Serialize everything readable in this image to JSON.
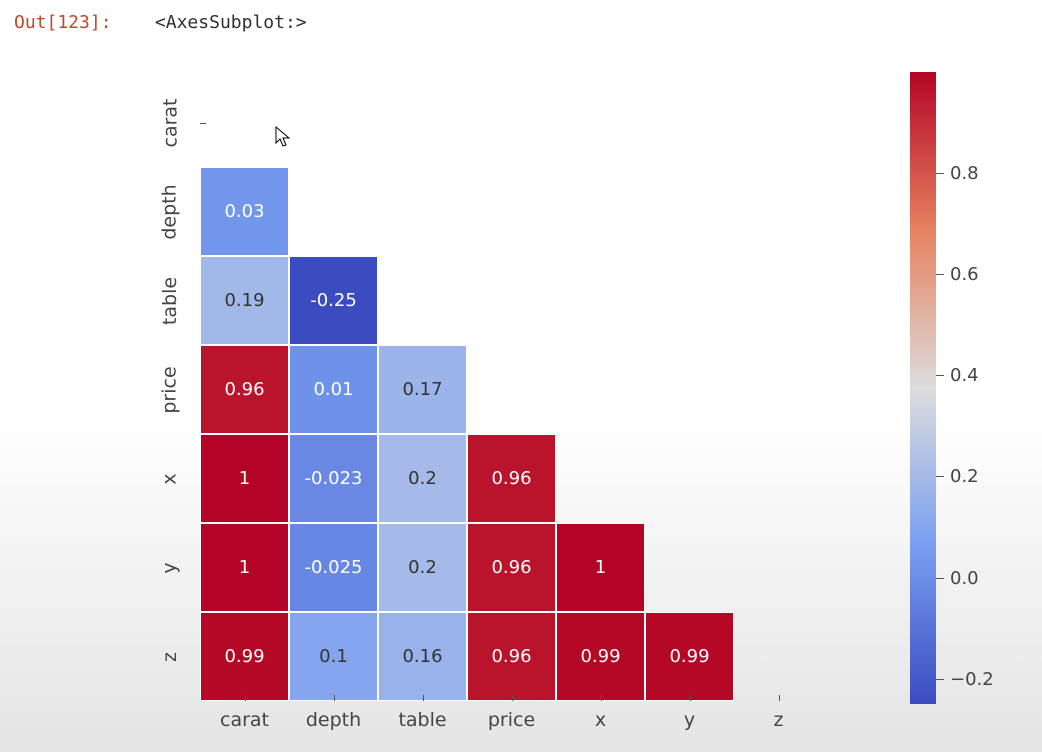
{
  "output_prompt": "Out[123]:",
  "output_text": "<AxesSubplot:>",
  "chart_data": {
    "type": "heatmap",
    "description": "Lower-triangular correlation heatmap (diagonal masked).",
    "row_labels": [
      "carat",
      "depth",
      "table",
      "price",
      "x",
      "y",
      "z"
    ],
    "col_labels": [
      "carat",
      "depth",
      "table",
      "price",
      "x",
      "y",
      "z"
    ],
    "matrix": [
      [
        null,
        null,
        null,
        null,
        null,
        null,
        null
      ],
      [
        0.03,
        null,
        null,
        null,
        null,
        null,
        null
      ],
      [
        0.19,
        -0.25,
        null,
        null,
        null,
        null,
        null
      ],
      [
        0.96,
        0.01,
        0.17,
        null,
        null,
        null,
        null
      ],
      [
        1,
        -0.023,
        0.2,
        0.96,
        null,
        null,
        null
      ],
      [
        1,
        -0.025,
        0.2,
        0.96,
        1,
        null,
        null
      ],
      [
        0.99,
        0.1,
        0.16,
        0.96,
        0.99,
        0.99,
        null
      ]
    ],
    "colorbar": {
      "ticks": [
        -0.2,
        0.0,
        0.2,
        0.4,
        0.6,
        0.8
      ],
      "vmin": -0.25,
      "vmax": 1.0
    },
    "colormap": "coolwarm"
  }
}
